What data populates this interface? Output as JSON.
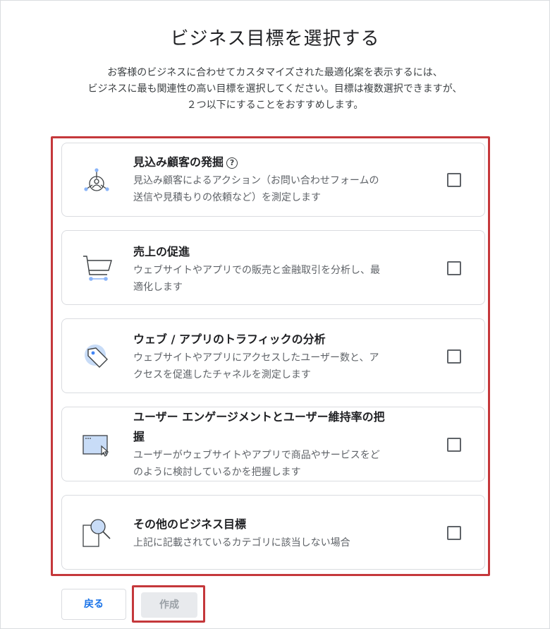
{
  "title": "ビジネス目標を選択する",
  "description": {
    "line1": "お客様のビジネスに合わせてカスタマイズされた最適化案を表示するには、",
    "line2": "ビジネスに最も関連性の高い目標を選択してください。目標は複数選択できますが、",
    "line3": "２つ以下にすることをおすすめします。"
  },
  "goals": [
    {
      "title": "見込み顧客の発掘",
      "help_icon": "help-icon",
      "help_glyph": "?",
      "subtitle_line1": "見込み顧客によるアクション（お問い合わせフォームの",
      "subtitle_line2": "送信や見積もりの依頼など）を測定します",
      "icon": "lead-target-icon",
      "checked": false
    },
    {
      "title": "売上の促進",
      "subtitle_line1": "ウェブサイトやアプリでの販売と金融取引を分析し、最",
      "subtitle_line2": "適化します",
      "icon": "cart-icon",
      "checked": false
    },
    {
      "title": "ウェブ / アプリのトラフィックの分析",
      "subtitle_line1": "ウェブサイトやアプリにアクセスしたユーザー数と、ア",
      "subtitle_line2": "クセスを促進したチャネルを測定します",
      "icon": "tag-icon",
      "checked": false
    },
    {
      "title_line1": "ユーザー エンゲージメントとユーザー維持率の把",
      "title_line2": "握",
      "subtitle_line1": "ユーザーがウェブサイトやアプリで商品やサービスをど",
      "subtitle_line2": "のように検討しているかを把握します",
      "icon": "browser-cursor-icon",
      "checked": false
    },
    {
      "title": "その他のビジネス目標",
      "subtitle_line1": "上記に記載されているカテゴリに該当しない場合",
      "icon": "magnifier-icon",
      "checked": false
    }
  ],
  "buttons": {
    "back": "戻る",
    "create": "作成"
  },
  "colors": {
    "highlight": "#c5383b",
    "accent_blue": "#1a73e8",
    "icon_fill": "#c8dcf7"
  }
}
